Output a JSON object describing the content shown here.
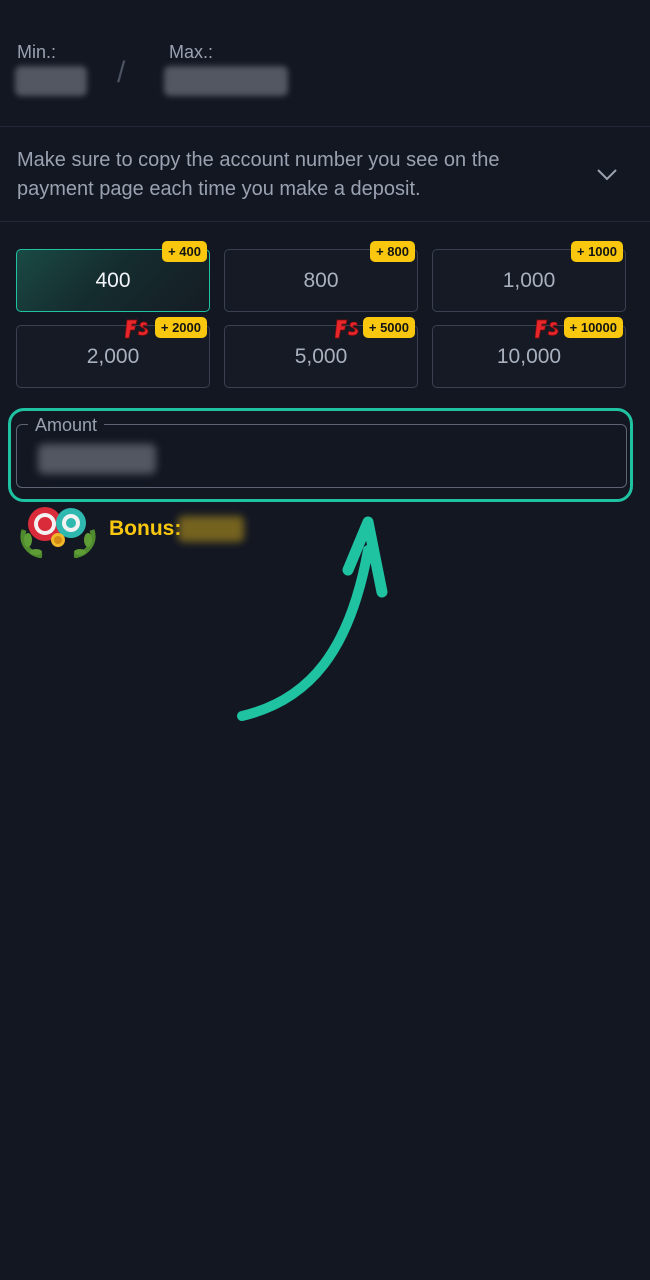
{
  "limits": {
    "min_label": "Min.:",
    "max_label": "Max.:",
    "separator": "/"
  },
  "notice": {
    "text": "Make sure to copy the account number you see on the payment page each time you make a deposit."
  },
  "presets": [
    {
      "amount": "400",
      "bonus": "+ 400",
      "free_spins": false,
      "selected": true
    },
    {
      "amount": "800",
      "bonus": "+ 800",
      "free_spins": false,
      "selected": false
    },
    {
      "amount": "1,000",
      "bonus": "+ 1000",
      "free_spins": false,
      "selected": false
    },
    {
      "amount": "2,000",
      "bonus": "+ 2000",
      "free_spins": true,
      "selected": false
    },
    {
      "amount": "5,000",
      "bonus": "+ 5000",
      "free_spins": true,
      "selected": false
    },
    {
      "amount": "10,000",
      "bonus": "+ 10000",
      "free_spins": true,
      "selected": false
    }
  ],
  "amount_field": {
    "label": "Amount"
  },
  "bonus": {
    "label": "Bonus:"
  },
  "icons": {
    "expand": "chevron-down-icon",
    "free_spins": "free-spins-icon",
    "bonus": "chips-wreath-icon",
    "annotation": "arrow-annotation"
  },
  "colors": {
    "background": "#131722",
    "accent": "#1fc3a2",
    "badge": "#f9c80e",
    "bonus_text": "#f9c80e"
  }
}
